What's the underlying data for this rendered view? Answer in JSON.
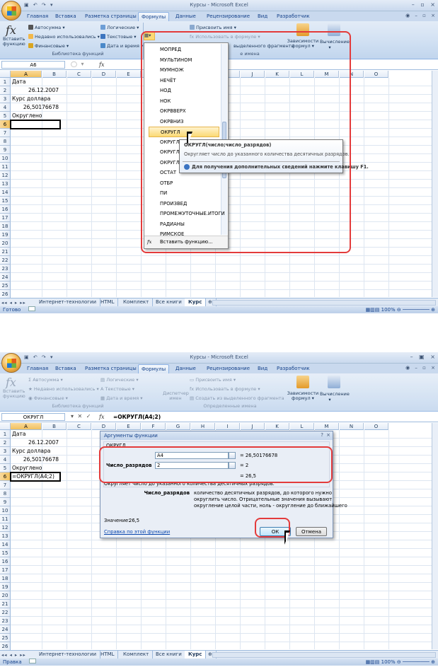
{
  "shot1": {
    "title": "Курсы - Microsoft Excel",
    "tabs": [
      "Главная",
      "Вставка",
      "Разметка страницы",
      "Формулы",
      "Данные",
      "Рецензирование",
      "Вид",
      "Разработчик"
    ],
    "active_tab": "Формулы",
    "ribbon": {
      "insert_fn": "Вставить функцию",
      "autosum": "Автосумма",
      "recent": "Недавно использовались",
      "financial": "Финансовые",
      "logical": "Логические",
      "text": "Текстовые",
      "datetime": "Дата и время",
      "group_library": "Библиотека функций",
      "assign_name": "Присвоить имя",
      "use_in_formula": "Использовать в формуле",
      "create_from_sel": "выделенного фрагмента",
      "group_names": "е имена",
      "dependencies": "Зависимости формул",
      "calculation": "Вычисление"
    },
    "namebox": "A6",
    "formula": "",
    "columns": [
      "A",
      "B",
      "C",
      "D",
      "E",
      "F",
      "G",
      "H",
      "I",
      "J",
      "K",
      "L",
      "M",
      "N",
      "O"
    ],
    "rows": [
      "1",
      "2",
      "3",
      "4",
      "5",
      "6",
      "7",
      "8",
      "9",
      "10",
      "11",
      "12",
      "13",
      "14",
      "15",
      "16",
      "17",
      "18",
      "19",
      "20",
      "21",
      "22",
      "23",
      "24",
      "25",
      "26"
    ],
    "cells": {
      "A1": "Дата",
      "A2": "26.12.2007",
      "A3": "Курс доллара",
      "A4": "26,50176678",
      "A5": "Округлено"
    },
    "dropdown": [
      "МОПРЕД",
      "МУЛЬТИНОМ",
      "МУМНОЖ",
      "НЕЧЁТ",
      "НОД",
      "НОК",
      "ОКРВВЕРХ",
      "ОКРВНИЗ",
      "ОКРУГЛ",
      "ОКРУГЛ",
      "ОКРУГЛ",
      "ОКРУГЛ",
      "ОСТАТ",
      "ОТБР",
      "ПИ",
      "ПРОИЗВЕД",
      "ПРОМЕЖУТОЧНЫЕ.ИТОГИ",
      "РАДИАНЫ",
      "РИМСКОЕ"
    ],
    "dropdown_hover": "ОКРУГЛ",
    "dropdown_footer": "Вставить функцию...",
    "tooltip": {
      "syntax": "ОКРУГЛ(число;число_разрядов)",
      "desc": "Округляет число до указанного количества десятичных разрядов.",
      "help": "Для получения дополнительных сведений нажмите клавишу F1."
    },
    "sheets": [
      "Интернет-технологии",
      "HTML",
      "Комплект",
      "Все книги",
      "Курс"
    ],
    "active_sheet": "Курс",
    "status": "Готово",
    "zoom": "100%"
  },
  "shot2": {
    "title": "Курсы - Microsoft Excel",
    "ribbon": {
      "insert_fn": "Вставить функцию",
      "autosum": "Автосумма",
      "recent": "Недавно использовались",
      "financial": "Финансовые",
      "logical": "Логические",
      "text": "Текстовые",
      "datetime": "Дата и время",
      "group_library": "Библиотека функций",
      "dispatcher": "Диспетчер имен",
      "assign_name": "Присвоить имя",
      "use_in_formula": "Использовать в формуле",
      "create_from_sel": "Создать из выделенного фрагмента",
      "group_names": "Определенные имена",
      "dependencies": "Зависимости формул",
      "calculation": "Вычисление"
    },
    "namebox": "ОКРУГЛ",
    "formula": "=ОКРУГЛ(A4;2)",
    "cells": {
      "A1": "Дата",
      "A2": "26.12.2007",
      "A3": "Курс доллара",
      "A4": "26,50176678",
      "A5": "Округлено",
      "A6": "=ОКРУГЛ(A4;2)"
    },
    "dialog": {
      "title": "Аргументы функции",
      "fn": "ОКРУГЛ",
      "arg1_label": "Число",
      "arg1_value": "A4",
      "arg1_result": "= 26,50176678",
      "arg2_label": "Число_разрядов",
      "arg2_value": "2",
      "arg2_result": "= 2",
      "result": "= 26,5",
      "desc": "Округляет число до указанного количества десятичных разрядов.",
      "param_name": "Число_разрядов",
      "param_desc1": "количество десятичных разрядов, до которого нужно",
      "param_desc2": "округлить число. Отрицательные значения вызывают",
      "param_desc3": "округление целой части, ноль - округление до ближайшего",
      "value_label": "Значение:",
      "value": "26,5",
      "help_link": "Справка по этой функции",
      "ok": "ОК",
      "cancel": "Отмена"
    },
    "status": "Правка",
    "zoom": "100%"
  },
  "colors": {
    "accent": "#e33b3b",
    "ribbon": "#cfdff2",
    "hover": "#fbd974"
  }
}
